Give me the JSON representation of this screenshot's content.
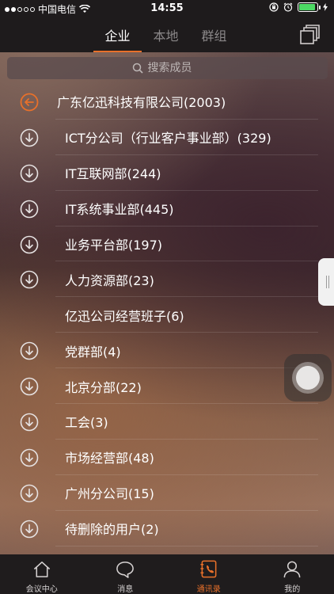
{
  "status_bar": {
    "carrier": "中国电信",
    "time": "14:55"
  },
  "nav": {
    "tabs": [
      {
        "label": "企业",
        "active": true
      },
      {
        "label": "本地",
        "active": false
      },
      {
        "label": "群组",
        "active": false
      }
    ]
  },
  "search": {
    "placeholder": "搜索成员"
  },
  "list": {
    "parent": "广东亿迅科技有限公司(2003)",
    "items": [
      {
        "label": "ICT分公司（行业客户事业部）(329)",
        "expandable": true
      },
      {
        "label": "IT互联网部(244)",
        "expandable": true
      },
      {
        "label": "IT系统事业部(445)",
        "expandable": true
      },
      {
        "label": "业务平台部(197)",
        "expandable": true
      },
      {
        "label": "人力资源部(23)",
        "expandable": true
      },
      {
        "label": "亿迅公司经营班子(6)",
        "expandable": false
      },
      {
        "label": "党群部(4)",
        "expandable": true
      },
      {
        "label": "北京分部(22)",
        "expandable": true
      },
      {
        "label": "工会(3)",
        "expandable": true
      },
      {
        "label": "市场经营部(48)",
        "expandable": true
      },
      {
        "label": "广州分公司(15)",
        "expandable": true
      },
      {
        "label": "待删除的用户(2)",
        "expandable": true
      }
    ]
  },
  "tab_bar": {
    "items": [
      {
        "label": "会议中心",
        "icon": "home-icon"
      },
      {
        "label": "消息",
        "icon": "chat-bubble-icon"
      },
      {
        "label": "通讯录",
        "icon": "contacts-book-icon",
        "active": true
      },
      {
        "label": "我的",
        "icon": "person-icon"
      }
    ]
  },
  "colors": {
    "accent": "#e8702a"
  }
}
